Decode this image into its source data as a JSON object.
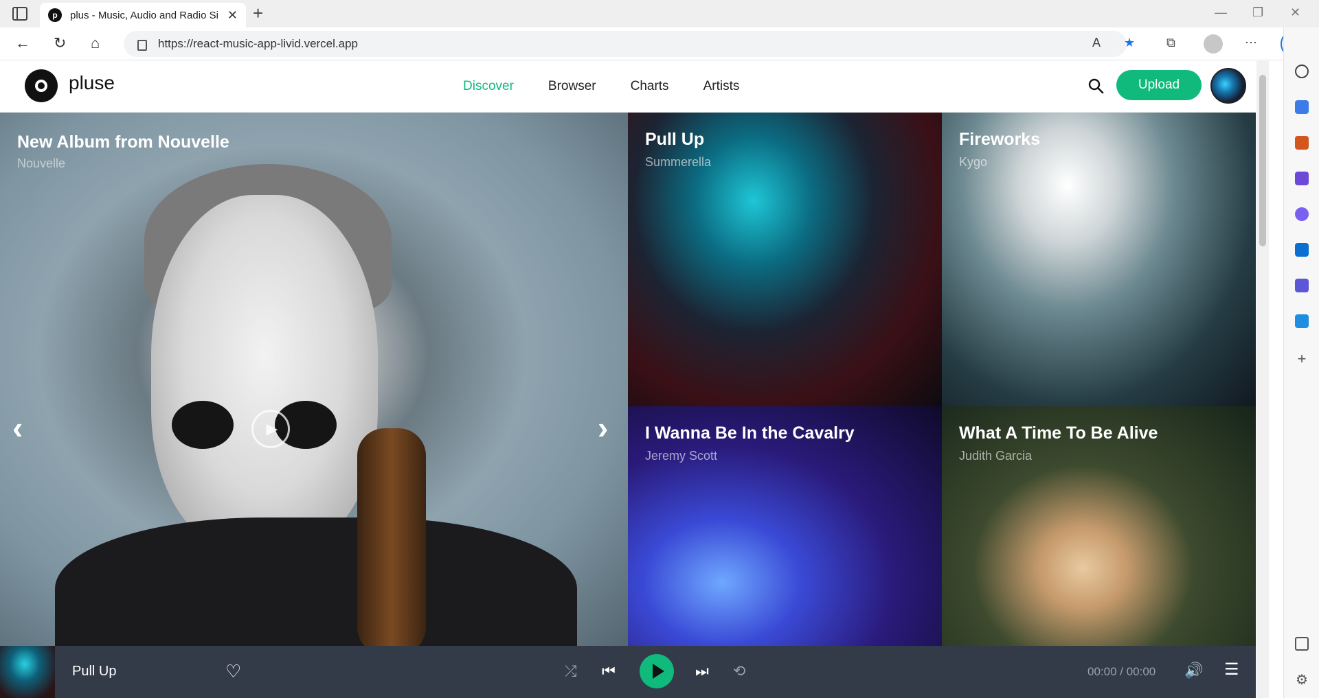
{
  "browser": {
    "tab_title": "plus - Music, Audio and Radio Si",
    "tab_favicon": "p",
    "url": "https://react-music-app-livid.vercel.app"
  },
  "site": {
    "logo_text": "pluse",
    "nav": [
      {
        "label": "Discover",
        "active": true
      },
      {
        "label": "Browser",
        "active": false
      },
      {
        "label": "Charts",
        "active": false
      },
      {
        "label": "Artists",
        "active": false
      }
    ],
    "upload_label": "Upload",
    "accent": "#0fba7c"
  },
  "hero": {
    "title": "New Album from Nouvelle",
    "subtitle": "Nouvelle"
  },
  "tiles": [
    {
      "title": "Pull Up",
      "subtitle": "Summerella"
    },
    {
      "title": "Fireworks",
      "subtitle": "Kygo"
    },
    {
      "title": "I Wanna Be In the Cavalry",
      "subtitle": "Jeremy Scott"
    },
    {
      "title": "What A Time To Be Alive",
      "subtitle": "Judith Garcia"
    }
  ],
  "player": {
    "track_title": "Pull Up",
    "time": "00:00 / 00:00"
  }
}
